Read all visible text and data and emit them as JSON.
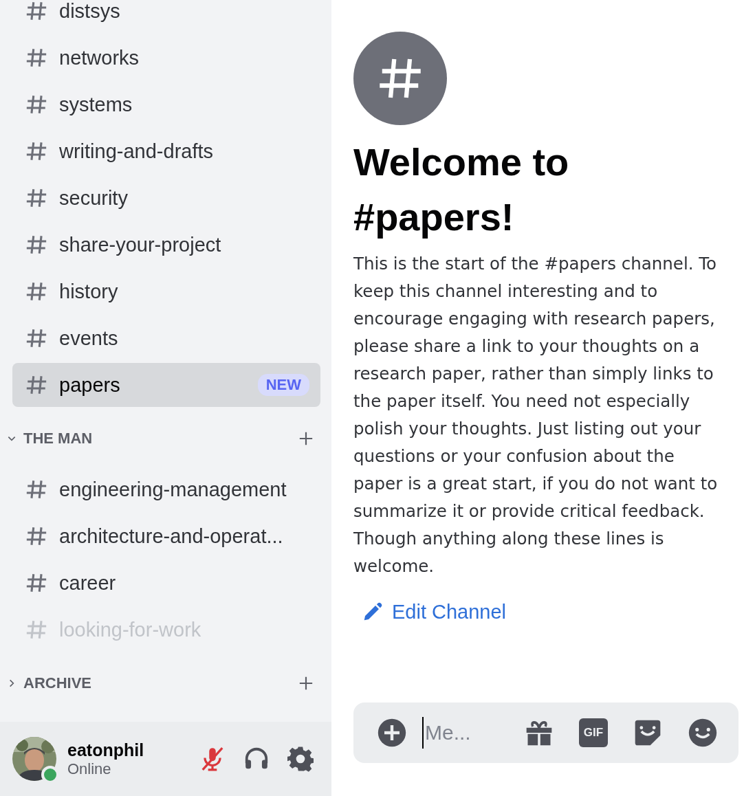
{
  "sidebar": {
    "channels": [
      {
        "name": "distsys",
        "selected": false,
        "muted": false
      },
      {
        "name": "networks",
        "selected": false,
        "muted": false
      },
      {
        "name": "systems",
        "selected": false,
        "muted": false
      },
      {
        "name": "writing-and-drafts",
        "selected": false,
        "muted": false
      },
      {
        "name": "security",
        "selected": false,
        "muted": false
      },
      {
        "name": "share-your-project",
        "selected": false,
        "muted": false
      },
      {
        "name": "history",
        "selected": false,
        "muted": false
      },
      {
        "name": "events",
        "selected": false,
        "muted": false
      },
      {
        "name": "papers",
        "selected": true,
        "muted": false,
        "badge": "NEW"
      }
    ],
    "categories": [
      {
        "name": "THE MAN",
        "expanded": true,
        "channels": [
          {
            "name": "engineering-management",
            "selected": false,
            "muted": false
          },
          {
            "name": "architecture-and-operat...",
            "selected": false,
            "muted": false
          },
          {
            "name": "career",
            "selected": false,
            "muted": false
          },
          {
            "name": "looking-for-work",
            "selected": false,
            "muted": true
          }
        ]
      },
      {
        "name": "ARCHIVE",
        "expanded": false
      }
    ]
  },
  "user": {
    "name": "eatonphil",
    "status": "Online",
    "online": true,
    "mic_muted": true
  },
  "main": {
    "title": "Welcome to #papers!",
    "description": "This is the start of the #papers channel. To keep this channel interesting and to encourage engaging with research papers, please share a link to your thoughts on a research paper, rather than simply links to the paper itself. You need not especially polish your thoughts. Just listing out your questions or your confusion about the paper is a great start, if you do not want to summarize it or provide critical feedback. Though anything along these lines is welcome.",
    "edit_link": "Edit Channel",
    "composer": {
      "placeholder": "Me...",
      "gif_label": "GIF"
    }
  }
}
